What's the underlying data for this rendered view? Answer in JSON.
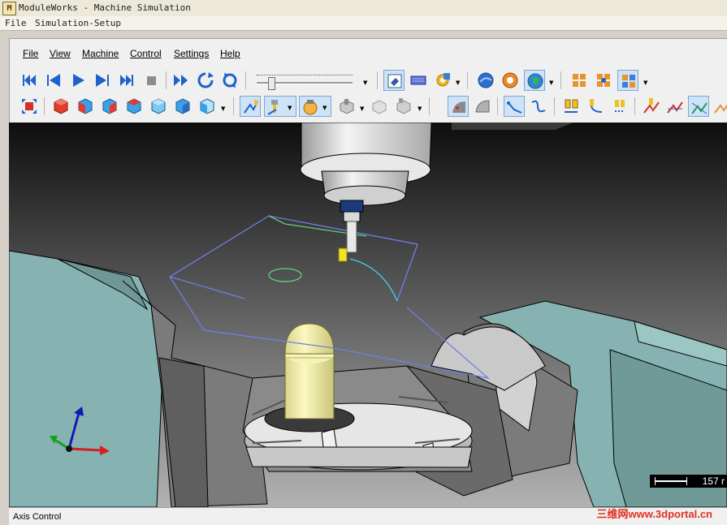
{
  "window": {
    "title": "ModuleWorks - Machine Simulation",
    "icon_text": "M"
  },
  "outer_menu": {
    "file": "File",
    "setup": "Simulation-Setup"
  },
  "menu": {
    "file": "File",
    "view": "View",
    "machine": "Machine",
    "control": "Control",
    "settings": "Settings",
    "help": "Help"
  },
  "toolbar1": {
    "icons": [
      "first-frame-icon",
      "step-back-icon",
      "play-icon",
      "step-forward-icon",
      "last-frame-icon",
      "stop-icon",
      "fast-forward-icon",
      "rotate-cw-icon",
      "loop-icon",
      "speed-slider",
      "eraser-icon",
      "keyboard-icon",
      "settings-gear-icon",
      "globe-left-icon",
      "donut-icon",
      "globe-icon",
      "collision-grid-icon",
      "collision-grid-2-icon",
      "collision-grid-3-icon"
    ],
    "slider_value": 0.1
  },
  "toolbar2": {
    "icons": [
      "fit-view-icon",
      "view-cube-red-icon",
      "view-cube-front-icon",
      "view-cube-right-icon",
      "view-cube-top-icon",
      "view-cube-iso-icon",
      "view-cube-back-icon",
      "tool-path-icon",
      "tool-icon",
      "tool-shading-icon",
      "stock-icon",
      "stock-ghost-icon",
      "stock-dropdown-icon",
      "solid-shade-icon",
      "wire-shade-icon",
      "path-line-icon",
      "path-curve-icon",
      "tool-holder-icon",
      "tool-path-move-icon",
      "tool-holder-2-icon",
      "path-red-icon",
      "path-green-icon",
      "path-orange-icon"
    ]
  },
  "viewport": {
    "scale_value": "157 r"
  },
  "status": {
    "text": "Axis Control"
  },
  "watermark": {
    "text": "三维网www.3dportal.cn"
  },
  "colors": {
    "background_top": "#141414",
    "background_bottom": "#a8a8a8",
    "machine_teal": "#86b3b1",
    "machine_gray": "#7e7e7e",
    "workpiece": "#f2f0a8",
    "path_blue": "#6e7fe6",
    "path_green": "#5ed37a",
    "path_cyan": "#43d3e6"
  }
}
